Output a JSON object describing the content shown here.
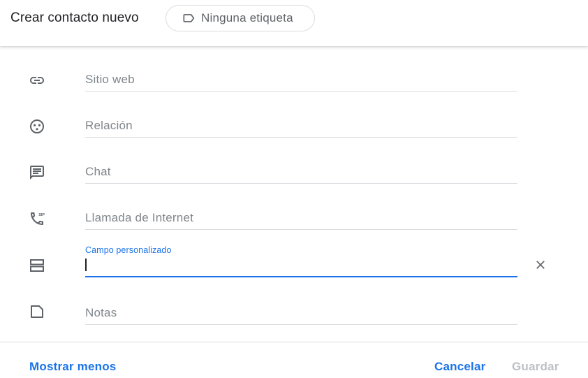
{
  "header": {
    "title": "Crear contacto nuevo",
    "label_chip": {
      "icon": "label-icon",
      "text": "Ninguna etiqueta"
    }
  },
  "fields": [
    {
      "icon": "link-icon",
      "placeholder": "Sitio web"
    },
    {
      "icon": "relationship-icon",
      "placeholder": "Relación"
    },
    {
      "icon": "chat-icon",
      "placeholder": "Chat"
    },
    {
      "icon": "sip-phone-icon",
      "placeholder": "Llamada de Internet"
    },
    {
      "icon": "custom-field-icon",
      "label": "Campo personalizado",
      "value": "",
      "focused": true,
      "clear_icon": "close-icon"
    },
    {
      "icon": "notes-icon",
      "placeholder": "Notas"
    }
  ],
  "footer": {
    "show_less": "Mostrar menos",
    "cancel": "Cancelar",
    "save": "Guardar"
  },
  "colors": {
    "accent": "#1a73e8",
    "icon": "#5f6368",
    "placeholder": "#80868b",
    "disabled": "#bdc1c6",
    "divider": "#dadce0"
  }
}
